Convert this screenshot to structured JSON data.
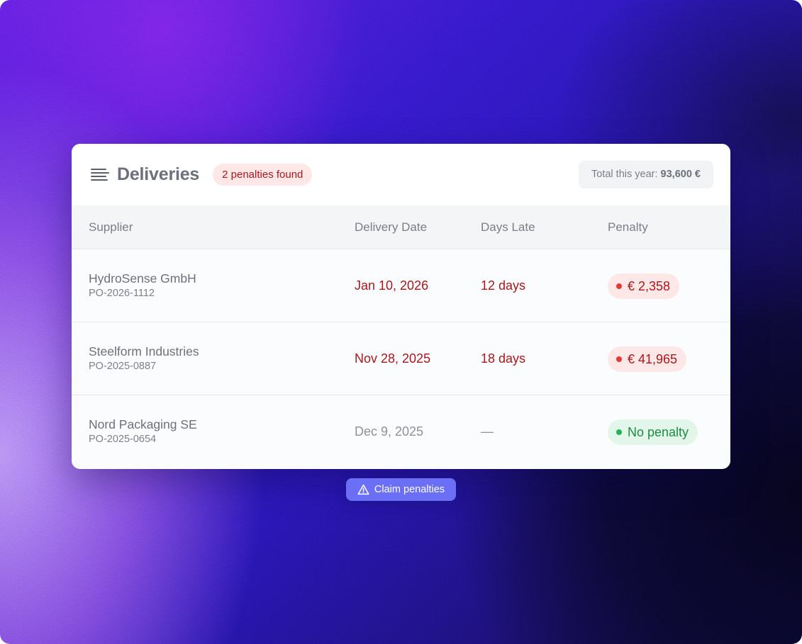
{
  "header": {
    "title": "Deliveries",
    "badge": "2 penalties found",
    "total_label": "Total this year:",
    "total_value": "93,600 €",
    "menu_icon": "menu-lines-icon"
  },
  "table": {
    "columns": [
      "Supplier",
      "Delivery Date",
      "Days Late",
      "Penalty"
    ],
    "rows": [
      {
        "supplier": "HydroSense GmbH",
        "po": "PO-2026-1112",
        "date": "Jan 10, 2026",
        "days_late": "12 days",
        "penalty": "€ 2,358",
        "status": "penalty"
      },
      {
        "supplier": "Steelform Industries",
        "po": "PO-2025-0887",
        "date": "Nov 28, 2025",
        "days_late": "18 days",
        "penalty": "€ 41,965",
        "status": "penalty"
      },
      {
        "supplier": "Nord Packaging SE",
        "po": "PO-2025-0654",
        "date": "Dec 9, 2025",
        "days_late": "—",
        "penalty": "No penalty",
        "status": "ok"
      }
    ]
  },
  "action": {
    "label": "Claim penalties",
    "icon": "warning-triangle-icon"
  },
  "colors": {
    "late": "#a8171c",
    "penalty_dot": "#e53935",
    "ok": "#1e8a45",
    "ok_dot": "#22b455",
    "button": "#6b6ff5"
  }
}
